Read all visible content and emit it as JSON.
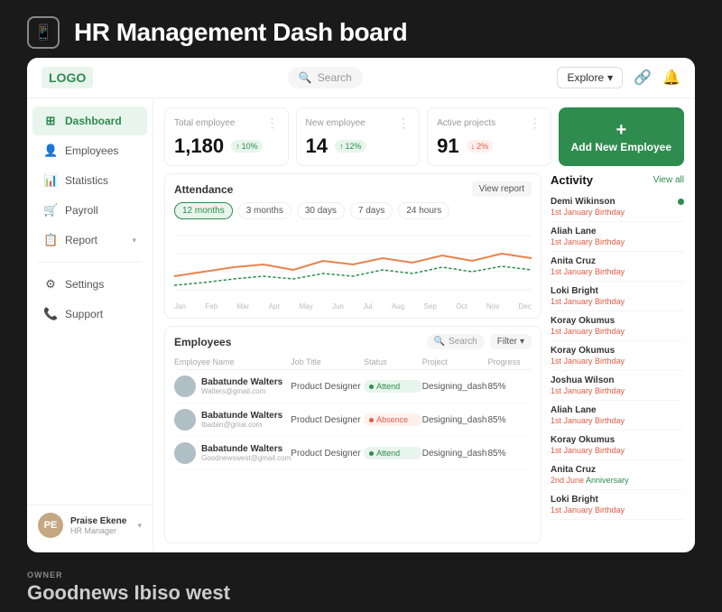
{
  "page": {
    "title": "HR Management Dash board",
    "icon": "📱"
  },
  "topbar": {
    "logo": "LOGO",
    "search_placeholder": "Search",
    "explore_label": "Explore",
    "notifications": "🔔",
    "share": "🔗"
  },
  "sidebar": {
    "items": [
      {
        "label": "Dashboard",
        "icon": "⊞",
        "active": true
      },
      {
        "label": "Employees",
        "icon": "👤",
        "active": false
      },
      {
        "label": "Statistics",
        "icon": "📊",
        "active": false
      },
      {
        "label": "Payroll",
        "icon": "🛒",
        "active": false
      },
      {
        "label": "Report",
        "icon": "📋",
        "active": false
      }
    ],
    "bottom_items": [
      {
        "label": "Settings",
        "icon": "⚙"
      },
      {
        "label": "Support",
        "icon": "📞"
      }
    ],
    "user": {
      "name": "Praise Ekene",
      "role": "HR Manager"
    }
  },
  "stats": [
    {
      "label": "Total employee",
      "value": "1,180",
      "change": "10%",
      "direction": "up"
    },
    {
      "label": "New employee",
      "value": "14",
      "change": "12%",
      "direction": "up"
    },
    {
      "label": "Active projects",
      "value": "91",
      "change": "2%",
      "direction": "down"
    }
  ],
  "add_employee": {
    "plus": "+",
    "label": "Add New Employee"
  },
  "attendance": {
    "title": "Attendance",
    "view_report": "View report",
    "filters": [
      "12 months",
      "3 months",
      "30 days",
      "7 days",
      "24 hours"
    ],
    "active_filter": "12 months",
    "months": [
      "Jan",
      "Feb",
      "Mar",
      "Apr",
      "May",
      "Jun",
      "Jul",
      "Aug",
      "Sep",
      "Oct",
      "Nov",
      "Dec"
    ]
  },
  "employees": {
    "title": "Employees",
    "search_placeholder": "Search",
    "filter_label": "Filter",
    "columns": [
      "Employee Name",
      "Job Title",
      "Status",
      "Project",
      "Progress"
    ],
    "rows": [
      {
        "name": "Babatunde Walters",
        "email": "Walters@gmail.com",
        "job": "Product Designer",
        "status": "Attend",
        "status_type": "attend",
        "project": "Designing_dash",
        "progress": "85%"
      },
      {
        "name": "Babatunde Walters",
        "email": "Ibadan@gmai.com",
        "job": "Product Designer",
        "status": "Absence",
        "status_type": "absence",
        "project": "Designing_dash",
        "progress": "85%"
      },
      {
        "name": "Babatunde Walters",
        "email": "Goodnewswest@gmail.com",
        "job": "Product Designer",
        "status": "Attend",
        "status_type": "attend",
        "project": "Designing_dash",
        "progress": "85%"
      }
    ]
  },
  "activity": {
    "title": "Activity",
    "view_all": "View all",
    "items": [
      {
        "name": "Demi Wikinson",
        "date": "1st January",
        "event": "Birthday",
        "event_type": "birthday",
        "dot": true
      },
      {
        "name": "Aliah Lane",
        "date": "1st January",
        "event": "Birthday",
        "event_type": "birthday",
        "dot": false
      },
      {
        "name": "Anita Cruz",
        "date": "1st January",
        "event": "Birthday",
        "event_type": "birthday",
        "dot": false
      },
      {
        "name": "Loki Bright",
        "date": "1st January",
        "event": "Birthday",
        "event_type": "birthday",
        "dot": false
      },
      {
        "name": "Koray Okumus",
        "date": "1st January",
        "event": "Birthday",
        "event_type": "birthday",
        "dot": false
      },
      {
        "name": "Koray Okumus",
        "date": "1st January",
        "event": "Birthday",
        "event_type": "birthday",
        "dot": false
      },
      {
        "name": "Joshua Wilson",
        "date": "1st January",
        "event": "Birthday",
        "event_type": "birthday",
        "dot": false
      },
      {
        "name": "Aliah Lane",
        "date": "1st January",
        "event": "Birthday",
        "event_type": "birthday",
        "dot": false
      },
      {
        "name": "Koray Okumus",
        "date": "1st January",
        "event": "Birthday",
        "event_type": "birthday",
        "dot": false
      },
      {
        "name": "Anita Cruz",
        "date": "2nd June",
        "event": "Anniversary",
        "event_type": "anniversary",
        "dot": false
      },
      {
        "name": "Loki Bright",
        "date": "1st January",
        "event": "Birthday",
        "event_type": "birthday",
        "dot": false
      }
    ]
  },
  "footer": {
    "owner_label": "OWNER",
    "owner_name": "Goodnews Ibiso west"
  }
}
